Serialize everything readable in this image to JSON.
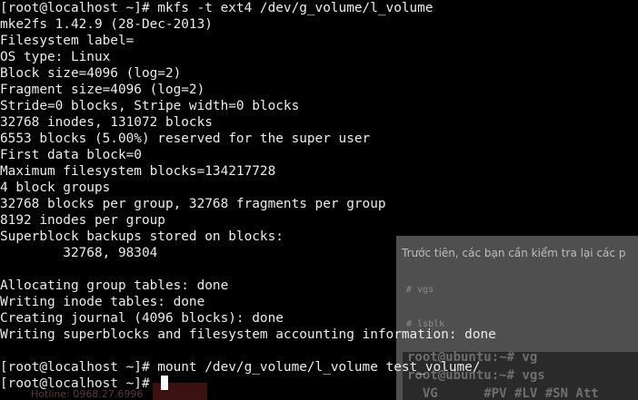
{
  "terminal": {
    "lines": [
      "[root@localhost ~]# mkfs -t ext4 /dev/g_volume/l_volume",
      "mke2fs 1.42.9 (28-Dec-2013)",
      "Filesystem label=",
      "OS type: Linux",
      "Block size=4096 (log=2)",
      "Fragment size=4096 (log=2)",
      "Stride=0 blocks, Stripe width=0 blocks",
      "32768 inodes, 131072 blocks",
      "6553 blocks (5.00%) reserved for the super user",
      "First data block=0",
      "Maximum filesystem blocks=134217728",
      "4 block groups",
      "32768 blocks per group, 32768 fragments per group",
      "8192 inodes per group",
      "Superblock backups stored on blocks:",
      "        32768, 98304",
      "",
      "Allocating group tables: done",
      "Writing inode tables: done",
      "Creating journal (4096 blocks): done",
      "Writing superblocks and filesystem accounting information: done",
      "",
      "[root@localhost ~]# mount /dev/g_volume/l_volume test_volume/",
      "[root@localhost ~]# "
    ]
  },
  "background_page": {
    "intro_text": "Trước tiên, các bạn cần kiểm tra lại các p",
    "code_lines": [
      "# vgs",
      "# lsblk"
    ],
    "terminal_lines": [
      "root@ubuntu:~# vg",
      "root@ubuntu:~# vgs",
      "  VG      #PV #LV #SN Att"
    ],
    "tab_text": "Hotline: 0968.27.6996"
  },
  "colors": {
    "terminal_bg": "#000000",
    "terminal_fg": "#ececec",
    "cursor": "#ffffff"
  }
}
